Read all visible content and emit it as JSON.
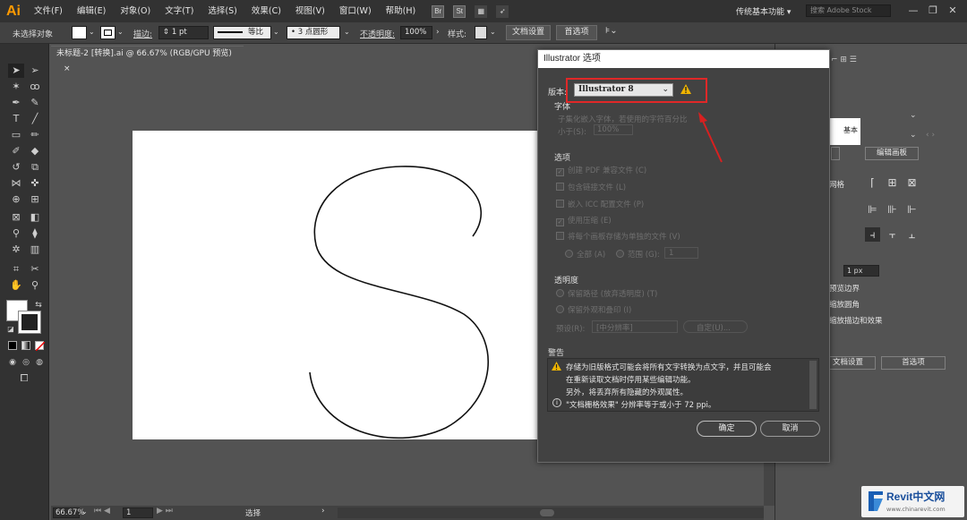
{
  "app": {
    "logo": "Ai"
  },
  "menu": [
    "文件(F)",
    "编辑(E)",
    "对象(O)",
    "文字(T)",
    "选择(S)",
    "效果(C)",
    "视图(V)",
    "窗口(W)",
    "帮助(H)"
  ],
  "menubar_icons": [
    "Br",
    "St"
  ],
  "workspace": {
    "label": "传统基本功能 ▾",
    "search_placeholder": "搜索 Adobe Stock"
  },
  "window_controls": [
    "—",
    "❐",
    "✕"
  ],
  "controlbar": {
    "selection": "未选择对象",
    "stroke_label": "描边:",
    "stroke_value": "1 pt",
    "profile": "等比",
    "brush": "3 点圆形",
    "opacity_label": "不透明度:",
    "opacity_value": "100%",
    "style_label": "样式:",
    "doc_setup": "文档设置",
    "prefs": "首选项"
  },
  "document": {
    "tab": "未标题-2 [转换].ai @ 66.67% (RGB/GPU 预览)",
    "tab_close": "×"
  },
  "statusbar": {
    "zoom": "66.67%",
    "page": "1",
    "tool": "选择"
  },
  "dialog": {
    "title": "Illustrator 选项",
    "version_label": "版本:",
    "version_value": "Illustrator 8",
    "font_section": "字体",
    "font_desc_1": "子集化嵌入字体，若使用的字符百分比",
    "font_desc_2": "小于(S):",
    "font_percent": "100%",
    "options_section": "选项",
    "options": [
      {
        "label": "创建 PDF 兼容文件 (C)",
        "checked": true
      },
      {
        "label": "包含链接文件 (L)",
        "checked": false
      },
      {
        "label": "嵌入 ICC 配置文件 (P)",
        "checked": false
      },
      {
        "label": "使用压缩 (E)",
        "checked": true
      },
      {
        "label": "将每个画板存储为单独的文件 (V)",
        "checked": false
      }
    ],
    "artboard_all": "全部 (A)",
    "artboard_range": "范围 (G):",
    "artboard_range_value": "1",
    "transparency_section": "透明度",
    "transparency_options": [
      "保留路径 (放弃透明度) (T)",
      "保留外观和叠印 (I)"
    ],
    "preset_label": "预设(R):",
    "preset_value": "[中分辨率]",
    "custom_button": "自定(U)...",
    "warning_section": "警告",
    "warnings": [
      "存储为旧版格式可能会将所有文字转换为点文字，并且可能会",
      "在重新读取文档时停用某些编辑功能。",
      "另外，将丢弃所有隐藏的外观属性。",
      "\"文档栅格效果\" 分辨率等于或小于 72 ppi。"
    ],
    "ok": "确定",
    "cancel": "取消"
  },
  "rightpanel": {
    "base_label": "基本",
    "edit_artboard": "编辑画板",
    "grid_label": "网格",
    "stroke_value": "1 px",
    "options": [
      "预览边界",
      "缩放圆角",
      "缩放描边和效果"
    ],
    "doc_setup": "文档设置",
    "prefs": "首选项"
  },
  "watermark": {
    "brand": "Revit中文网",
    "url": "www.chinarevit.com"
  },
  "colors": {
    "accent": "#ff9a00",
    "highlight": "#e02828",
    "panel": "#535353",
    "dark": "#323232"
  }
}
